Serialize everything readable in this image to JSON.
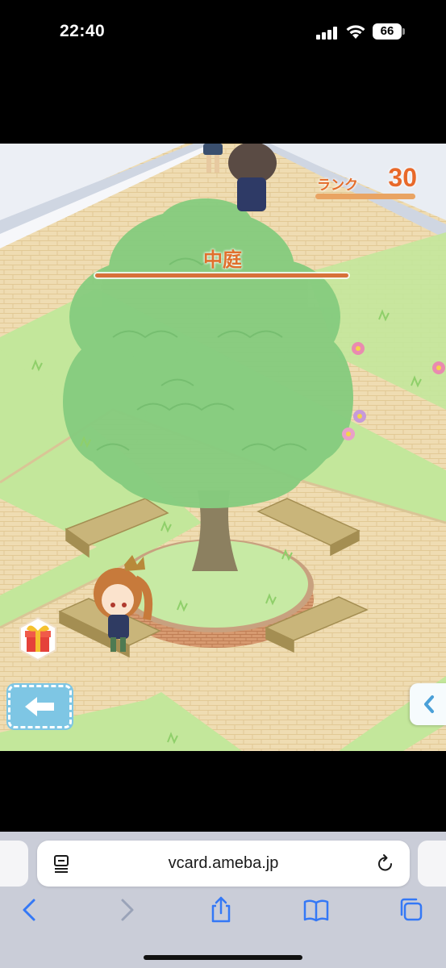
{
  "status_bar": {
    "time": "22:40",
    "battery_level": "66"
  },
  "game": {
    "rank_label": "ランク",
    "rank_value": "30",
    "rank_progress": 1.0,
    "location_name": "中庭",
    "back_icon": "left-arrow-icon",
    "side_tab_icon": "chevron-left-icon",
    "gift_icon": "gift-icon"
  },
  "browser": {
    "url": "vcard.ameba.jp",
    "toolbar": [
      "back-icon",
      "forward-icon",
      "share-icon",
      "bookmarks-icon",
      "tabs-icon"
    ],
    "accent_color": "#3478f6"
  }
}
